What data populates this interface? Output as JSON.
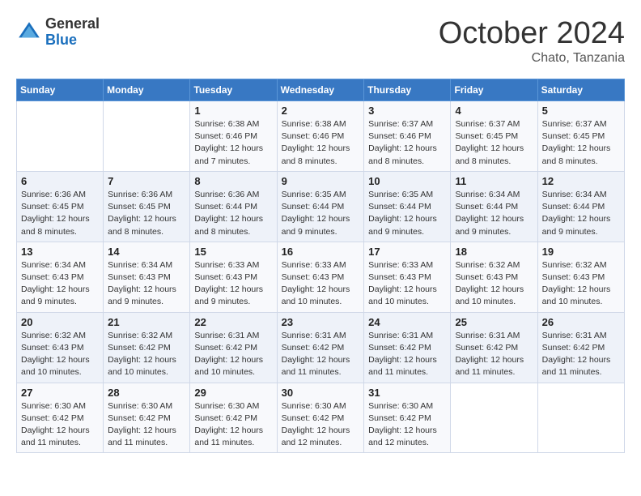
{
  "header": {
    "logo_general": "General",
    "logo_blue": "Blue",
    "month": "October 2024",
    "location": "Chato, Tanzania"
  },
  "weekdays": [
    "Sunday",
    "Monday",
    "Tuesday",
    "Wednesday",
    "Thursday",
    "Friday",
    "Saturday"
  ],
  "weeks": [
    [
      {
        "day": "",
        "info": ""
      },
      {
        "day": "",
        "info": ""
      },
      {
        "day": "1",
        "info": "Sunrise: 6:38 AM\nSunset: 6:46 PM\nDaylight: 12 hours and 7 minutes."
      },
      {
        "day": "2",
        "info": "Sunrise: 6:38 AM\nSunset: 6:46 PM\nDaylight: 12 hours and 8 minutes."
      },
      {
        "day": "3",
        "info": "Sunrise: 6:37 AM\nSunset: 6:46 PM\nDaylight: 12 hours and 8 minutes."
      },
      {
        "day": "4",
        "info": "Sunrise: 6:37 AM\nSunset: 6:45 PM\nDaylight: 12 hours and 8 minutes."
      },
      {
        "day": "5",
        "info": "Sunrise: 6:37 AM\nSunset: 6:45 PM\nDaylight: 12 hours and 8 minutes."
      }
    ],
    [
      {
        "day": "6",
        "info": "Sunrise: 6:36 AM\nSunset: 6:45 PM\nDaylight: 12 hours and 8 minutes."
      },
      {
        "day": "7",
        "info": "Sunrise: 6:36 AM\nSunset: 6:45 PM\nDaylight: 12 hours and 8 minutes."
      },
      {
        "day": "8",
        "info": "Sunrise: 6:36 AM\nSunset: 6:44 PM\nDaylight: 12 hours and 8 minutes."
      },
      {
        "day": "9",
        "info": "Sunrise: 6:35 AM\nSunset: 6:44 PM\nDaylight: 12 hours and 9 minutes."
      },
      {
        "day": "10",
        "info": "Sunrise: 6:35 AM\nSunset: 6:44 PM\nDaylight: 12 hours and 9 minutes."
      },
      {
        "day": "11",
        "info": "Sunrise: 6:34 AM\nSunset: 6:44 PM\nDaylight: 12 hours and 9 minutes."
      },
      {
        "day": "12",
        "info": "Sunrise: 6:34 AM\nSunset: 6:44 PM\nDaylight: 12 hours and 9 minutes."
      }
    ],
    [
      {
        "day": "13",
        "info": "Sunrise: 6:34 AM\nSunset: 6:43 PM\nDaylight: 12 hours and 9 minutes."
      },
      {
        "day": "14",
        "info": "Sunrise: 6:34 AM\nSunset: 6:43 PM\nDaylight: 12 hours and 9 minutes."
      },
      {
        "day": "15",
        "info": "Sunrise: 6:33 AM\nSunset: 6:43 PM\nDaylight: 12 hours and 9 minutes."
      },
      {
        "day": "16",
        "info": "Sunrise: 6:33 AM\nSunset: 6:43 PM\nDaylight: 12 hours and 10 minutes."
      },
      {
        "day": "17",
        "info": "Sunrise: 6:33 AM\nSunset: 6:43 PM\nDaylight: 12 hours and 10 minutes."
      },
      {
        "day": "18",
        "info": "Sunrise: 6:32 AM\nSunset: 6:43 PM\nDaylight: 12 hours and 10 minutes."
      },
      {
        "day": "19",
        "info": "Sunrise: 6:32 AM\nSunset: 6:43 PM\nDaylight: 12 hours and 10 minutes."
      }
    ],
    [
      {
        "day": "20",
        "info": "Sunrise: 6:32 AM\nSunset: 6:43 PM\nDaylight: 12 hours and 10 minutes."
      },
      {
        "day": "21",
        "info": "Sunrise: 6:32 AM\nSunset: 6:42 PM\nDaylight: 12 hours and 10 minutes."
      },
      {
        "day": "22",
        "info": "Sunrise: 6:31 AM\nSunset: 6:42 PM\nDaylight: 12 hours and 10 minutes."
      },
      {
        "day": "23",
        "info": "Sunrise: 6:31 AM\nSunset: 6:42 PM\nDaylight: 12 hours and 11 minutes."
      },
      {
        "day": "24",
        "info": "Sunrise: 6:31 AM\nSunset: 6:42 PM\nDaylight: 12 hours and 11 minutes."
      },
      {
        "day": "25",
        "info": "Sunrise: 6:31 AM\nSunset: 6:42 PM\nDaylight: 12 hours and 11 minutes."
      },
      {
        "day": "26",
        "info": "Sunrise: 6:31 AM\nSunset: 6:42 PM\nDaylight: 12 hours and 11 minutes."
      }
    ],
    [
      {
        "day": "27",
        "info": "Sunrise: 6:30 AM\nSunset: 6:42 PM\nDaylight: 12 hours and 11 minutes."
      },
      {
        "day": "28",
        "info": "Sunrise: 6:30 AM\nSunset: 6:42 PM\nDaylight: 12 hours and 11 minutes."
      },
      {
        "day": "29",
        "info": "Sunrise: 6:30 AM\nSunset: 6:42 PM\nDaylight: 12 hours and 11 minutes."
      },
      {
        "day": "30",
        "info": "Sunrise: 6:30 AM\nSunset: 6:42 PM\nDaylight: 12 hours and 12 minutes."
      },
      {
        "day": "31",
        "info": "Sunrise: 6:30 AM\nSunset: 6:42 PM\nDaylight: 12 hours and 12 minutes."
      },
      {
        "day": "",
        "info": ""
      },
      {
        "day": "",
        "info": ""
      }
    ]
  ]
}
